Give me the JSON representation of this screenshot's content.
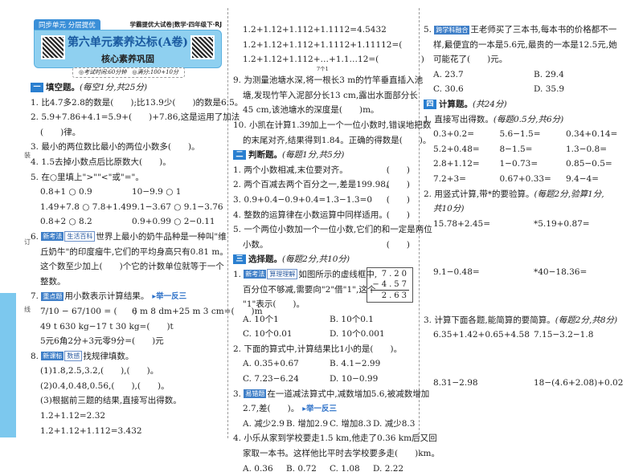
{
  "banner": {
    "tag": "同步单元 分层提优",
    "series": "学霸提优大试卷|数学·四年级下·RJ",
    "title": "第六单元素养达标(A卷)",
    "subtitle": "核心素养巩固",
    "info": "◎考试时间:60分钟　◎满分:100+10分"
  },
  "binding_marks": [
    "装",
    "订",
    "线"
  ],
  "left": [
    {
      "type": "section",
      "num": "一",
      "text": "填空题。",
      "note": "(每空1分,共25分)"
    },
    {
      "text": "1. 比4.7多2.8的数是(　　);比13.9少(　　)的数是6.5。"
    },
    {
      "text": "2. 5.9+7.86+4.1=5.9+(　　)+7.86,这是运用了加法"
    },
    {
      "type": "indent",
      "text": "(　　)律。"
    },
    {
      "text": "3. 最小的两位数比最小的两位小数多(　　)。"
    },
    {
      "text": "4. 1.5去掉小数点后比原数大(　　)。"
    },
    {
      "text": "5. 在○里填上\">\"\"<\"或\"=\"。"
    },
    {
      "type": "indent",
      "cols": [
        "0.8+1 ○ 0.9",
        "10−9.9 ○ 1"
      ]
    },
    {
      "type": "indent",
      "cols": [
        "1.49+7.8 ○ 7.8+1.49",
        "9.1−3.67 ○ 9.1−3.76"
      ]
    },
    {
      "type": "indent",
      "cols": [
        "0.8+2 ○ 8.2",
        "0.9+0.99 ○ 2−0.11"
      ]
    },
    {
      "badges": [
        "新考法",
        "生活百科"
      ],
      "prefix": "6. ",
      "text": "世界上最小的奶牛品种是一种叫\"维"
    },
    {
      "type": "indent",
      "text": "丘奶牛\"的印度瘤牛,它们的平均身高只有0.81 m。"
    },
    {
      "type": "indent",
      "text": "这个数至少加上(　　)个它的计数单位就等于一个"
    },
    {
      "type": "indent",
      "text": "整数。"
    },
    {
      "badges": [
        "重点题"
      ],
      "prefix": "7. ",
      "text": "用小数表示计算结果。",
      "link": "▸举一反三"
    },
    {
      "type": "indent",
      "cols": [
        "7/10 − 67/100 = (　　)",
        "6 m 8 dm+25 m 3 cm=(　　)m"
      ]
    },
    {
      "type": "indent",
      "text": "49 t 630 kg−17 t 30 kg=(　　)t"
    },
    {
      "type": "indent",
      "text": "5元6角2分+3元零9分=(　　)元"
    },
    {
      "badges": [
        "新课标",
        "数感"
      ],
      "prefix": "8. ",
      "text": "找规律填数。"
    },
    {
      "type": "indent",
      "text": "(1)1.8,2.5,3.2,(　　),(　　)。"
    },
    {
      "type": "indent",
      "text": "(2)0.4,0.48,0.56,(　　),(　　)。"
    },
    {
      "type": "indent",
      "text": "(3)根据前三题的结果,直接写出得数。"
    },
    {
      "type": "indent",
      "text": "1.2+1.12=2.32"
    },
    {
      "type": "indent",
      "text": "1.2+1.12+1.112=3.432"
    }
  ],
  "middle": [
    {
      "type": "indent",
      "text": "1.2+1.12+1.112+1.1112=4.5432"
    },
    {
      "type": "indent",
      "text": "1.2+1.12+1.112+1.1112+1.11112=(　　　　　)"
    },
    {
      "type": "indent",
      "text": "1.2+1.12+1.112+…+1.1…12=(　　　　　)",
      "sub": "7个1"
    },
    {
      "text": "9. 为测量池塘水深,将一根长3 m的竹竿垂直插入池"
    },
    {
      "type": "indent",
      "text": "塘,发现竹竿入泥部分长13 cm,露出水面部分长"
    },
    {
      "type": "indent",
      "text": "45 cm,该池塘水的深度是(　　)m。"
    },
    {
      "text": "10. 小凯在计算1.39加上一个一位小数时,错误地把数"
    },
    {
      "type": "indent",
      "text": "的末尾对齐,结果得到1.84。正确的得数是(　　)。"
    },
    {
      "type": "section",
      "num": "二",
      "text": "判断题。",
      "note": "(每题1分,共5分)"
    },
    {
      "text": "1. 两个小数相减,末位要对齐。",
      "paren": "(　　)"
    },
    {
      "text": "2. 两个百减去两个百分之一,差是199.98。",
      "paren": "(　　)"
    },
    {
      "text": "3. 0.9+0.4−0.9+0.4=1.3−1.3=0",
      "paren": "(　　)"
    },
    {
      "text": "4. 整数的运算律在小数运算中同样适用。",
      "paren": "(　　)"
    },
    {
      "text": "5. 一个两位小数加一个一位小数,它们的和一定是两位"
    },
    {
      "type": "indent",
      "text": "小数。",
      "paren": "(　　)"
    },
    {
      "type": "section",
      "num": "三",
      "text": "选择题。",
      "note": "(每题2分,共10分)"
    },
    {
      "badges": [
        "新考法",
        "算理理解"
      ],
      "prefix": "1. ",
      "text": "如图所示的虚线框中,",
      "vsub": [
        "7.20",
        "−4.57",
        "2.63"
      ]
    },
    {
      "type": "indent",
      "text": "百分位不够减,需要向\"2\"借\"1\",这个"
    },
    {
      "type": "indent",
      "text": "\"1\"表示(　　)。"
    },
    {
      "type": "indent",
      "cols": [
        "A. 10个1",
        "B. 10个0.1"
      ]
    },
    {
      "type": "indent",
      "cols": [
        "C. 10个0.01",
        "D. 10个0.001"
      ]
    },
    {
      "text": "2. 下面的算式中,计算结果比1小的是(　　)。"
    },
    {
      "type": "indent",
      "cols": [
        "A. 0.35+0.67",
        "B. 4.1−2.99"
      ]
    },
    {
      "type": "indent",
      "cols": [
        "C. 7.23−6.24",
        "D. 10−0.99"
      ]
    },
    {
      "badges": [
        "易错题"
      ],
      "prefix": "3. ",
      "text": "在一道减法算式中,减数增加5.6,被减数增加"
    },
    {
      "type": "indent",
      "text": "2.7,差(　　)。",
      "link": "▸举一反三"
    },
    {
      "type": "indent",
      "cols4": [
        "A. 减少2.9",
        "B. 增加2.9",
        "C. 增加8.3",
        "D. 减少8.3"
      ]
    },
    {
      "text": "4. 小乐从家到学校要走1.5 km,他走了0.36 km后又回"
    },
    {
      "type": "indent",
      "text": "家取一本书。这样他比平时去学校要多走(　　)km。"
    },
    {
      "type": "indent",
      "cols4": [
        "A. 0.36",
        "B. 0.72",
        "C. 1.08",
        "D. 2.22"
      ]
    }
  ],
  "right": [
    {
      "badges": [
        "跨学科融合"
      ],
      "prefix": "5. ",
      "text": "王老师买了三本书,每本书的价格都不一"
    },
    {
      "type": "indent",
      "text": "样,最便宜的一本是5.6元,最贵的一本是12.5元,她"
    },
    {
      "type": "indent",
      "text": "可能花了(　　)元。"
    },
    {
      "type": "indent",
      "cols": [
        "A. 23.7",
        "B. 29.4"
      ]
    },
    {
      "type": "indent",
      "cols": [
        "C. 30.6",
        "D. 35.9"
      ]
    },
    {
      "type": "section",
      "num": "四",
      "text": "计算题。",
      "note": "(共24分)"
    },
    {
      "text": "1. 直接写出得数。",
      "note": "(每题0.5分,共6分)"
    },
    {
      "type": "indent",
      "cols3": [
        "0.3+0.2=",
        "5.6−1.5=",
        "0.34+0.14="
      ]
    },
    {
      "type": "indent",
      "cols3": [
        "5.2+0.48=",
        "8−1.5=",
        "1.3−0.8="
      ]
    },
    {
      "type": "indent",
      "cols3": [
        "2.8+1.12=",
        "1−0.73=",
        "0.85−0.5="
      ]
    },
    {
      "type": "indent",
      "cols3": [
        "7.2+3=",
        "0.67+0.33=",
        "9.4−4="
      ]
    },
    {
      "text": "2. 用竖式计算,带*的要验算。",
      "note": "(每题2分,验算1分,"
    },
    {
      "type": "indent",
      "text": "",
      "note": "共10分)"
    },
    {
      "type": "indent",
      "cols": [
        "15.78+2.45=",
        "*5.19+0.87="
      ],
      "space": "xtall"
    },
    {
      "type": "indent",
      "cols": [
        "9.1−0.48=",
        "*40−18.36="
      ],
      "space": "xtall"
    },
    {
      "text": "3. 计算下面各题,能简算的要简算。",
      "note": "(每题2分,共8分)"
    },
    {
      "type": "indent",
      "cols": [
        "6.35+1.42+0.65+4.58",
        "7.15−3.2−1.8"
      ],
      "space": "xtall"
    },
    {
      "type": "indent",
      "cols": [
        "8.31−2.98",
        "18−(4.6+2.08)+0.02"
      ]
    }
  ]
}
